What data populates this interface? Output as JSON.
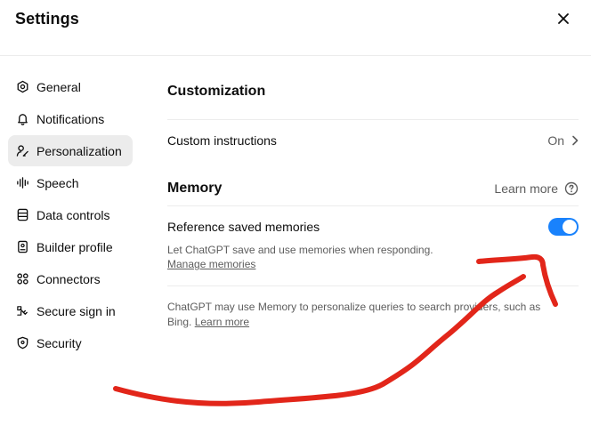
{
  "window": {
    "title": "Settings"
  },
  "sidebar": {
    "items": [
      {
        "label": "General",
        "icon": "gear-icon"
      },
      {
        "label": "Notifications",
        "icon": "bell-icon"
      },
      {
        "label": "Personalization",
        "icon": "person-icon",
        "active": true
      },
      {
        "label": "Speech",
        "icon": "waveform-icon"
      },
      {
        "label": "Data controls",
        "icon": "database-icon"
      },
      {
        "label": "Builder profile",
        "icon": "id-card-icon"
      },
      {
        "label": "Connectors",
        "icon": "connectors-icon"
      },
      {
        "label": "Secure sign in",
        "icon": "key-icon"
      },
      {
        "label": "Security",
        "icon": "shield-icon"
      }
    ]
  },
  "customization": {
    "title": "Customization",
    "custom_instructions": {
      "label": "Custom instructions",
      "value": "On"
    }
  },
  "memory": {
    "title": "Memory",
    "learn_more": "Learn more",
    "reference_saved": {
      "label": "Reference saved memories",
      "enabled": true,
      "description": "Let ChatGPT save and use memories when responding.",
      "manage_link": "Manage memories"
    },
    "note": {
      "text": "ChatGPT may use Memory to personalize queries to search providers, such as Bing.",
      "link": "Learn more"
    }
  },
  "colors": {
    "toggle_on": "#1982fc",
    "annotation_stroke": "#e2261a"
  }
}
